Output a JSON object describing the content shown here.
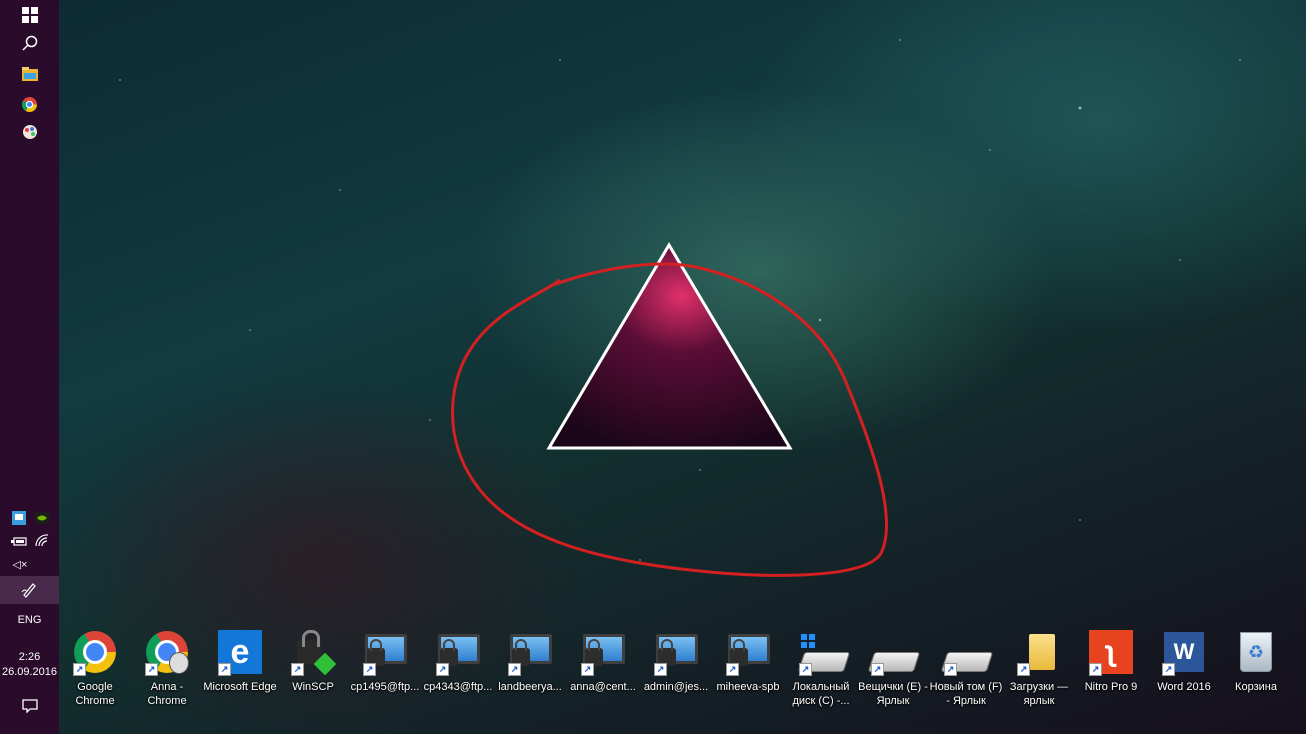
{
  "taskbar": {
    "clock_time": "2:26",
    "clock_date": "26.09.2016",
    "language": "ENG",
    "mute_indicator": "◁×",
    "icons": {
      "start": "windows-logo-icon",
      "search": "search-icon",
      "explorer": "file-explorer-icon",
      "chrome": "chrome-icon",
      "paint": "paint-icon",
      "tray_network_adapter": "network-app-icon",
      "tray_nvidia": "nvidia-icon",
      "tray_battery": "battery-icon",
      "tray_wifi": "wifi-icon",
      "tray_pen": "pen-workspace-icon",
      "action_center": "action-center-icon"
    }
  },
  "desktop": {
    "icons": [
      {
        "label": "Google Chrome",
        "icon": "chrome-icon"
      },
      {
        "label": "Anna - Chrome",
        "icon": "chrome-profile-icon"
      },
      {
        "label": "Microsoft Edge",
        "icon": "edge-icon"
      },
      {
        "label": "WinSCP",
        "icon": "winscp-icon"
      },
      {
        "label": "cp1495@ftp...",
        "icon": "remote-connection-icon"
      },
      {
        "label": "cp4343@ftp...",
        "icon": "remote-connection-icon"
      },
      {
        "label": "landbeerya...",
        "icon": "remote-connection-icon"
      },
      {
        "label": "anna@cent...",
        "icon": "remote-connection-icon"
      },
      {
        "label": "admin@jes...",
        "icon": "remote-connection-icon"
      },
      {
        "label": "miheeva-spb",
        "icon": "remote-connection-icon"
      },
      {
        "label": "Локальный диск (C) -...",
        "icon": "system-drive-icon"
      },
      {
        "label": "Вещички (E) - Ярлык",
        "icon": "drive-icon"
      },
      {
        "label": "Новый том (F) - Ярлык",
        "icon": "drive-icon"
      },
      {
        "label": "Загрузки — ярлык",
        "icon": "folder-icon"
      },
      {
        "label": "Nitro Pro 9",
        "icon": "nitro-pdf-icon"
      },
      {
        "label": "Word 2016",
        "icon": "word-icon"
      },
      {
        "label": "Корзина",
        "icon": "recycle-bin-icon"
      }
    ],
    "shortcut_arrow": "↗"
  },
  "wallpaper": {
    "triangle_stroke": "#ffffff",
    "annotation_color": "#d42020"
  }
}
